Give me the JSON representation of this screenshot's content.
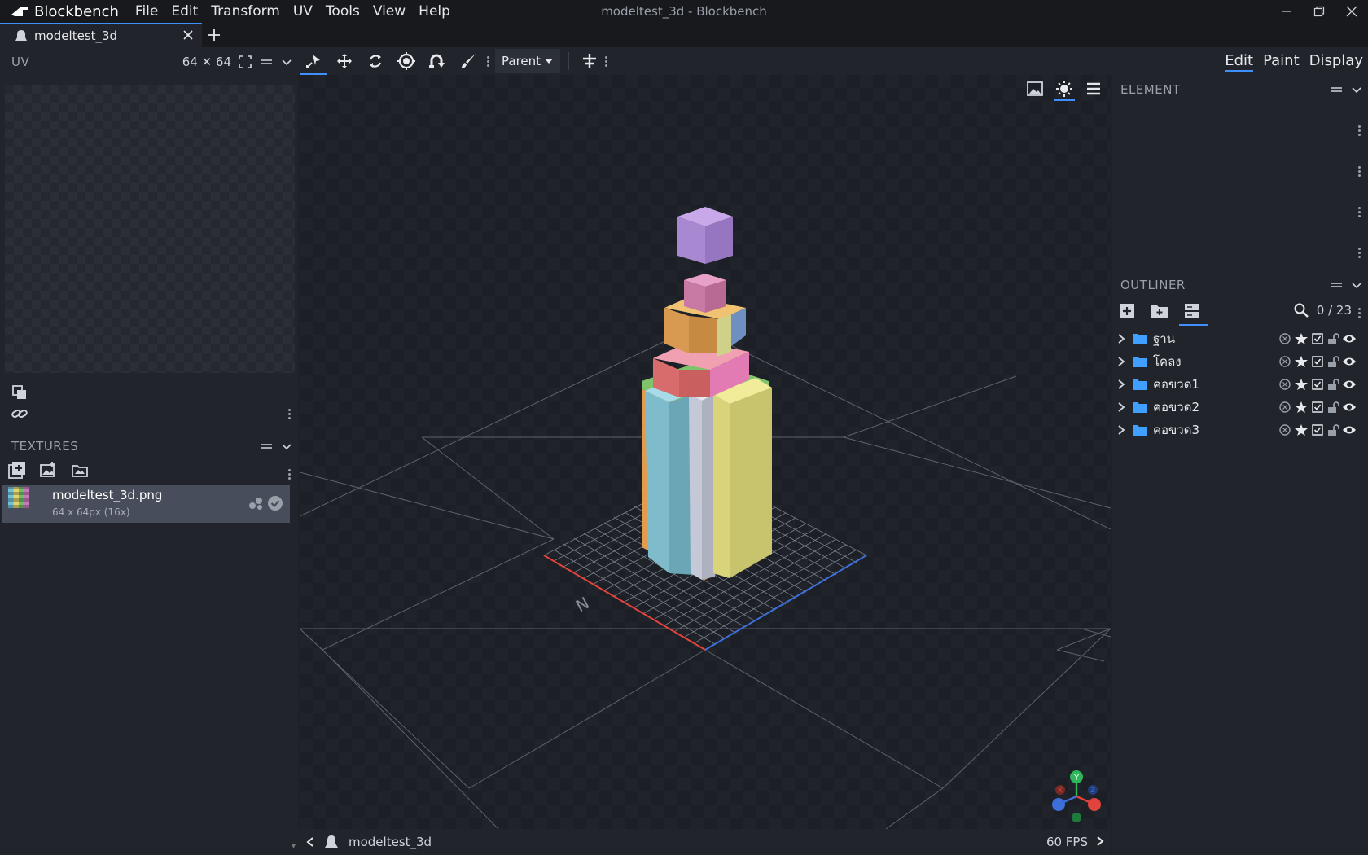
{
  "app": {
    "name": "Blockbench",
    "window_title": "modeltest_3d - Blockbench"
  },
  "menus": [
    "File",
    "Edit",
    "Transform",
    "UV",
    "Tools",
    "View",
    "Help"
  ],
  "tab": {
    "label": "modeltest_3d"
  },
  "uv_panel": {
    "title": "UV",
    "size": "64 ✕ 64"
  },
  "textures_panel": {
    "title": "TEXTURES",
    "items": [
      {
        "name": "modeltest_3d.png",
        "size": "64 x 64px (16x)"
      }
    ]
  },
  "toolbar": {
    "transform_space": "Parent"
  },
  "modes": [
    "Edit",
    "Paint",
    "Display"
  ],
  "element_panel": {
    "title": "ELEMENT"
  },
  "outliner": {
    "title": "OUTLINER",
    "count": "0 / 23",
    "groups": [
      "ฐาน",
      "โคลง",
      "คอขวด1",
      "คอขวด2",
      "คอขวด3"
    ]
  },
  "statusbar": {
    "model_name": "modeltest_3d",
    "fps": "60 FPS"
  },
  "gizmo": {
    "axes": [
      "Y",
      "X",
      "Z"
    ],
    "colors": {
      "x": "#e0443c",
      "y": "#2fb55a",
      "z": "#3d6fd8"
    }
  },
  "colors": {
    "accent": "#3e90ff",
    "bg": "#1e2127",
    "panel": "#21252b"
  }
}
